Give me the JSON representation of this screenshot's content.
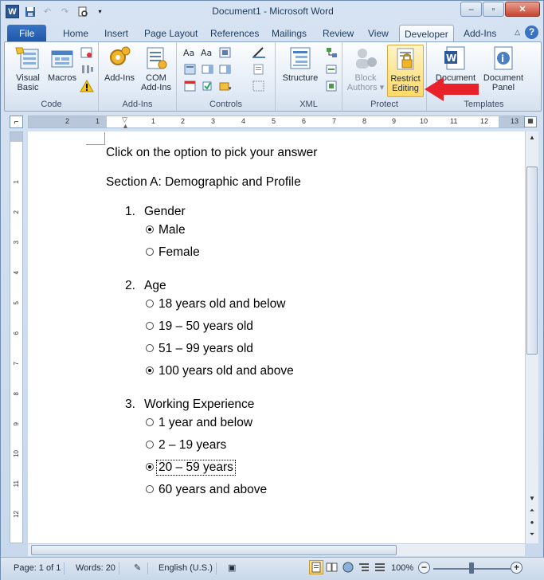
{
  "window": {
    "title": "Document1  -  Microsoft Word",
    "controls": [
      "–",
      "▫",
      "✕"
    ]
  },
  "tabs": [
    {
      "label": "File"
    },
    {
      "label": "Home"
    },
    {
      "label": "Insert"
    },
    {
      "label": "Page Layout"
    },
    {
      "label": "References"
    },
    {
      "label": "Mailings"
    },
    {
      "label": "Review"
    },
    {
      "label": "View"
    },
    {
      "label": "Developer"
    },
    {
      "label": "Add-Ins"
    }
  ],
  "ribbon": {
    "groups": [
      {
        "label": "Code"
      },
      {
        "label": "Add-Ins"
      },
      {
        "label": "Controls"
      },
      {
        "label": "XML"
      },
      {
        "label": "Protect"
      },
      {
        "label": "Templates"
      }
    ],
    "buttons": {
      "visual_basic_1": "Visual",
      "visual_basic_2": "Basic",
      "macros": "Macros",
      "addins": "Add-Ins",
      "com_addins_1": "COM",
      "com_addins_2": "Add-Ins",
      "structure": "Structure",
      "block_authors_1": "Block",
      "block_authors_2": "Authors",
      "restrict_editing_1": "Restrict",
      "restrict_editing_2": "Editing",
      "document_template_1": "Document",
      "document_panel_1": "Document",
      "document_panel_2": "Panel"
    }
  },
  "ruler": {
    "h_numbers": [
      "2",
      "1",
      "1",
      "2",
      "3",
      "4",
      "5",
      "6",
      "7",
      "8",
      "9",
      "10",
      "11",
      "12",
      "13"
    ],
    "v_numbers": [
      "1",
      "2",
      "3",
      "4",
      "5",
      "6",
      "7",
      "8",
      "9",
      "10",
      "11",
      "12"
    ]
  },
  "document": {
    "instruction": "Click on the option to pick your answer",
    "section": "Section A: Demographic and Profile",
    "questions": [
      {
        "number": "1.",
        "text": "Gender",
        "options": [
          {
            "label": "Male",
            "selected": true
          },
          {
            "label": "Female",
            "selected": false
          }
        ]
      },
      {
        "number": "2.",
        "text": "Age",
        "options": [
          {
            "label": "18 years old and below",
            "selected": false
          },
          {
            "label": "19 – 50 years old",
            "selected": false
          },
          {
            "label": "51 – 99 years old",
            "selected": false
          },
          {
            "label": "100 years old and above",
            "selected": true
          }
        ]
      },
      {
        "number": "3.",
        "text": "Working Experience",
        "options": [
          {
            "label": "1 year and below",
            "selected": false
          },
          {
            "label": "2 – 19 years",
            "selected": false
          },
          {
            "label": "20 – 59 years",
            "selected": true
          },
          {
            "label": "60 years and above",
            "selected": false
          }
        ]
      }
    ]
  },
  "status": {
    "page": "Page: 1 of 1",
    "words": "Words: 20",
    "language": "English (U.S.)",
    "zoom": "100%"
  },
  "colors": {
    "arrow": "#e8222a",
    "highlight": "#ffd968"
  },
  "icons": {
    "arrow": "red-arrow-pointing-left"
  }
}
